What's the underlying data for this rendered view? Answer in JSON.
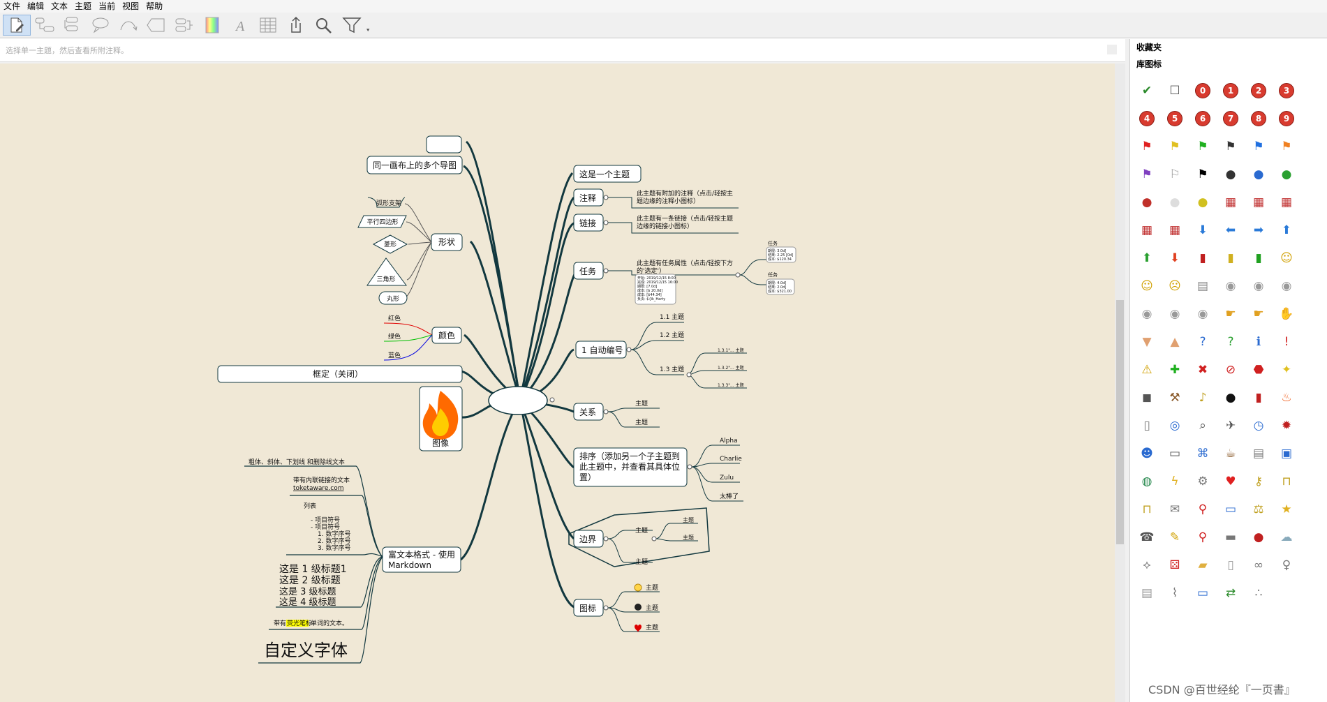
{
  "menu": [
    "文件",
    "编辑",
    "文本",
    "主题",
    "当前",
    "视图",
    "帮助"
  ],
  "toolbar": {
    "tools": [
      "new-topic-icon",
      "subtopic-icon",
      "sibling-icon",
      "callout-icon",
      "relationship-icon",
      "boundary-icon",
      "group-icon",
      "color-icon",
      "font-icon",
      "table-icon",
      "share-icon",
      "search-icon",
      "filter-icon"
    ],
    "more": "⯆"
  },
  "notes": {
    "placeholder": "选择单一主题，然后查看所附注释。"
  },
  "sidebar": {
    "favorites": "收藏夹",
    "library": "库图标",
    "icons": [
      "check-icon",
      "checkbox-icon",
      "num-0",
      "num-1",
      "num-2",
      "num-3",
      "num-4",
      "num-5",
      "num-6",
      "num-7",
      "num-8",
      "num-9",
      "flag-red-icon",
      "flag-yellow-icon",
      "flag-green-icon",
      "flag-black-icon",
      "flag-blue-icon",
      "flag-orange-icon",
      "flag-purple-icon",
      "flag-white-icon",
      "flag-checkered-icon",
      "hat-black-icon",
      "hat-blue-icon",
      "hat-green-icon",
      "hat-red-icon",
      "hat-white-icon",
      "hat-yellow-icon",
      "calendar-icon",
      "calendar-icon",
      "calendar-icon",
      "calendar-icon",
      "calendar-icon",
      "arrow-down-icon",
      "arrow-left-icon",
      "arrow-right-icon",
      "arrow-up-icon",
      "arrow-up-green-icon",
      "arrow-down-red-icon",
      "traffic-red-icon",
      "traffic-yellow-icon",
      "traffic-green-icon",
      "smiley-happy-icon",
      "smiley-neutral-icon",
      "smiley-sad-icon",
      "money-icon",
      "coin-icon",
      "coin-icon",
      "coin-icon",
      "coin-icon",
      "coin-icon",
      "coin-icon",
      "hand-point-icon",
      "hand-point-icon",
      "hand-stop-icon",
      "thumbs-down-icon",
      "thumbs-up-icon",
      "question-blue-icon",
      "question-green-icon",
      "info-icon",
      "exclamation-icon",
      "warning-icon",
      "plus-icon",
      "cross-icon",
      "forbidden-icon",
      "stop-icon",
      "bulb-icon",
      "camera-icon",
      "hammer-icon",
      "bell-icon",
      "bomb-icon",
      "dynamite-icon",
      "fire-icon",
      "trash-icon",
      "target-icon",
      "magnifier-icon",
      "airplane-icon",
      "clock-icon",
      "bug-icon",
      "people-icon",
      "phone-icon",
      "network-icon",
      "coffee-icon",
      "database-icon",
      "computer-icon",
      "globe-icon",
      "lightning-icon",
      "gear-icon",
      "heart-icon",
      "key-icon",
      "unlock-icon",
      "lock-icon",
      "mail-icon",
      "pin-icon",
      "car-icon",
      "scale-icon",
      "star-icon",
      "telephone-icon",
      "pencil-icon",
      "pushpin-icon",
      "disk-icon",
      "bomb-red-icon",
      "cloud-icon",
      "compass-icon",
      "dice-icon",
      "folder-icon",
      "document-icon",
      "link-icon",
      "female-icon",
      "newspaper-icon",
      "paperclip-icon",
      "presentation-icon",
      "signpost-icon",
      "footprints-icon"
    ]
  },
  "mindmap": {
    "left": {
      "blank": "",
      "multi_maps": "同一画布上的多个导图",
      "shapes": "形状",
      "shape_items": [
        "弧形支架",
        "平行四边形",
        "菱形",
        "三角形",
        "丸形"
      ],
      "colors": "颜色",
      "color_items": [
        "红色",
        "绿色",
        "蓝色"
      ],
      "frame": "框定（关闭）",
      "image": "图像",
      "richtext": "富文本格式 - 使用",
      "richtext2": "Markdown",
      "rt_line1": "粗体、斜体、下划线 和删除线文本",
      "rt_line2a": "带有内联链接的文本",
      "rt_line2b": "toketaware.com",
      "rt_list": [
        "列表",
        "- 项目符号",
        "- 项目符号",
        "1. 数字序号",
        "2. 数字序号",
        "3. 数字序号"
      ],
      "headings": [
        "这是 1 级标题1",
        "这是 2 级标题",
        "这是 3 级标题",
        "这是 4 级标题"
      ],
      "highlight_pre": "带有",
      "highlight_mid": "荧光笔标",
      "highlight_post": "单词的文本。",
      "custom_font": "自定义字体"
    },
    "right": {
      "topic": "这是一个主题",
      "note": "注释",
      "note_text": [
        "此主题有附加的注释（点击/轻按主",
        "题边缘的注释小图标）"
      ],
      "link": "链接",
      "link_text": [
        "此主题有一条链接（点击/轻按主题",
        "边缘的链接小图标）"
      ],
      "task": "任务",
      "task_text": [
        "此主题有任务属性（点击/轻按下方",
        "的'选定'）"
      ],
      "task_box": [
        "开始: 2019/12/15 8:00",
        "完成: 2019/12/15 16:00",
        "期限: [7.0d]",
        "成本: [$ 20.0d]",
        "成本: [$44.34]",
        "负责: ${ik_Harty"
      ],
      "task_sub": "任务",
      "task_sub_box1": [
        "期限: 3.0d]",
        "结果: 2.25 [0d]",
        "成本: $120.34"
      ],
      "task_sub_box2": [
        "期限: 4.0d]",
        "结果: 2.0d]",
        "成本: $321.00"
      ],
      "autonum": "1 自动编号",
      "auto_items": [
        "1.1 主题",
        "1.2 主题",
        "1.3 主题"
      ],
      "auto_sub": [
        "1.3.1\"... 主题",
        "1.3.2\"... 主题",
        "1.3.3\"... 主题"
      ],
      "relation": "关系",
      "relation_items": [
        "主题",
        "主题"
      ],
      "sort": [
        "排序（添加另一个子主题到",
        "此主题中，并查看其具体位",
        "置）"
      ],
      "sort_items": [
        "Alpha",
        "Charlie",
        "Zulu",
        "太棒了"
      ],
      "boundary": "边界",
      "boundary_items": [
        "主题",
        "主题"
      ],
      "boundary_sub": [
        "主题",
        "主题"
      ],
      "icons_topic": "图标",
      "icons_items": [
        "主题",
        "主题",
        "主题"
      ]
    }
  },
  "colors": {
    "branch": "#12383f",
    "canvas": "#f0e8d6",
    "red": "#e00000",
    "green": "#00c000",
    "blue": "#0000e0",
    "highlight": "#ffff00"
  },
  "watermark": "CSDN @百世经纶『一页書』"
}
